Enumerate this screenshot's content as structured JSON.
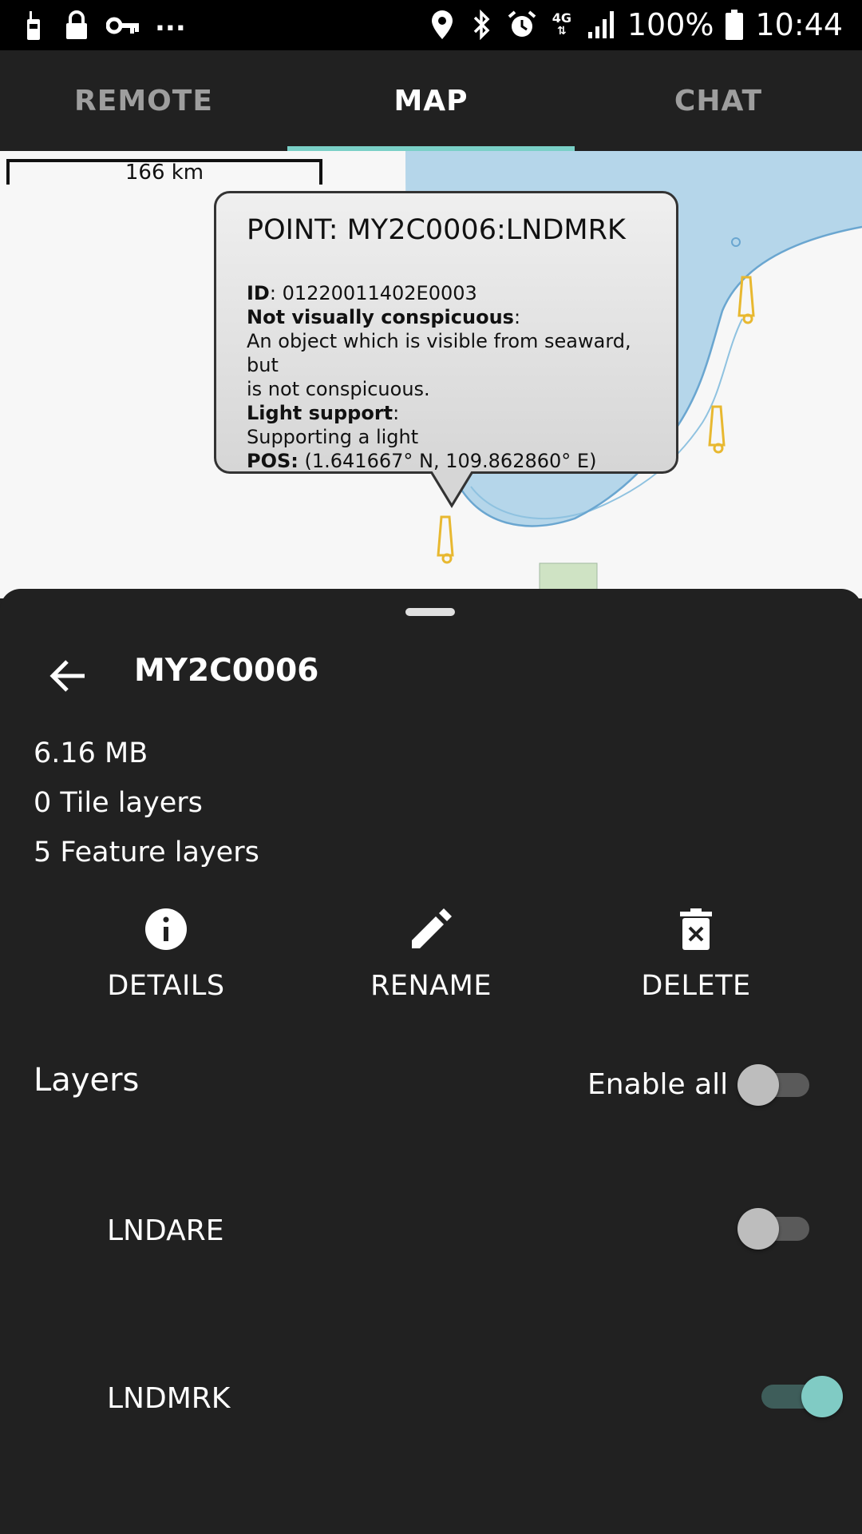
{
  "status_bar": {
    "icons_left": [
      "walkie-talkie-icon",
      "lock-icon",
      "key-icon"
    ],
    "overflow": "...",
    "icons_right": [
      "location-icon",
      "bluetooth-icon",
      "alarm-icon",
      "network-4g-icon",
      "signal-icon"
    ],
    "network": "4G",
    "battery": "100%",
    "time": "10:44"
  },
  "tabs": [
    {
      "label": "REMOTE",
      "active": false
    },
    {
      "label": "MAP",
      "active": true
    },
    {
      "label": "CHAT",
      "active": false
    }
  ],
  "map": {
    "scale_label": "166 km",
    "water_color": "#b5d6ea",
    "land_color": "#f7f7f7",
    "marker_color": "#e8b830",
    "callout": {
      "title": "POINT: MY2C0006:LNDMRK",
      "id_label": "ID",
      "id_value": ": 01220011402E0003",
      "field1_label": "Not visually conspicuous",
      "field1_colon": ":",
      "field1_value_line1": "An object which is visible from seaward, but",
      "field1_value_line2": "is not conspicuous.",
      "field2_label": "Light support",
      "field2_colon": ":",
      "field2_value": "Supporting a light",
      "pos_label": "POS:",
      "pos_value": " (1.641667° N, 109.862860° E)"
    }
  },
  "sheet": {
    "title": "MY2C0006",
    "size": "6.16 MB",
    "tile_layers": "0 Tile layers",
    "feature_layers": "5 Feature layers",
    "actions": [
      {
        "label": "DETAILS",
        "icon": "info-icon"
      },
      {
        "label": "RENAME",
        "icon": "pencil-icon"
      },
      {
        "label": "DELETE",
        "icon": "trash-icon"
      }
    ],
    "layers_heading": "Layers",
    "enable_all_label": "Enable all",
    "enable_all_on": false,
    "layers": [
      {
        "name": "LNDARE",
        "enabled": false
      },
      {
        "name": "LNDMRK",
        "enabled": true
      }
    ],
    "accent_color": "#80cbc4"
  }
}
